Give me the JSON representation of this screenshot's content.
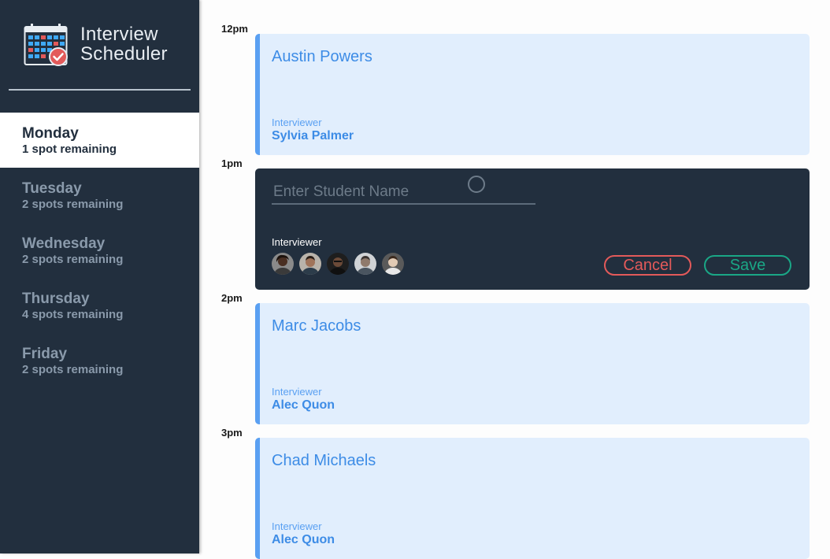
{
  "app": {
    "title_line1": "Interview",
    "title_line2": "Scheduler"
  },
  "days": [
    {
      "name": "Monday",
      "spots": "1 spot remaining",
      "selected": true
    },
    {
      "name": "Tuesday",
      "spots": "2 spots remaining"
    },
    {
      "name": "Wednesday",
      "spots": "2 spots remaining"
    },
    {
      "name": "Thursday",
      "spots": "4 spots remaining"
    },
    {
      "name": "Friday",
      "spots": "2 spots remaining"
    }
  ],
  "schedule": {
    "slots": [
      {
        "time": "12pm",
        "student": "Austin Powers",
        "interviewer_label": "Interviewer",
        "interviewer": "Sylvia Palmer"
      },
      {
        "time": "1pm"
      },
      {
        "time": "2pm",
        "student": "Marc Jacobs",
        "interviewer_label": "Interviewer",
        "interviewer": "Alec Quon"
      },
      {
        "time": "3pm",
        "student": "Chad Michaels",
        "interviewer_label": "Interviewer",
        "interviewer": "Alec Quon"
      }
    ],
    "form": {
      "placeholder": "Enter Student Name",
      "interviewer_label": "Interviewer",
      "cancel_label": "Cancel",
      "save_label": "Save"
    }
  },
  "colors": {
    "sidebar_bg": "#222f3e",
    "appointment_bg": "#e1eefd",
    "accent_blue": "#3d8ce6",
    "cancel_red": "#e35a5a",
    "save_green": "#1aa786"
  }
}
